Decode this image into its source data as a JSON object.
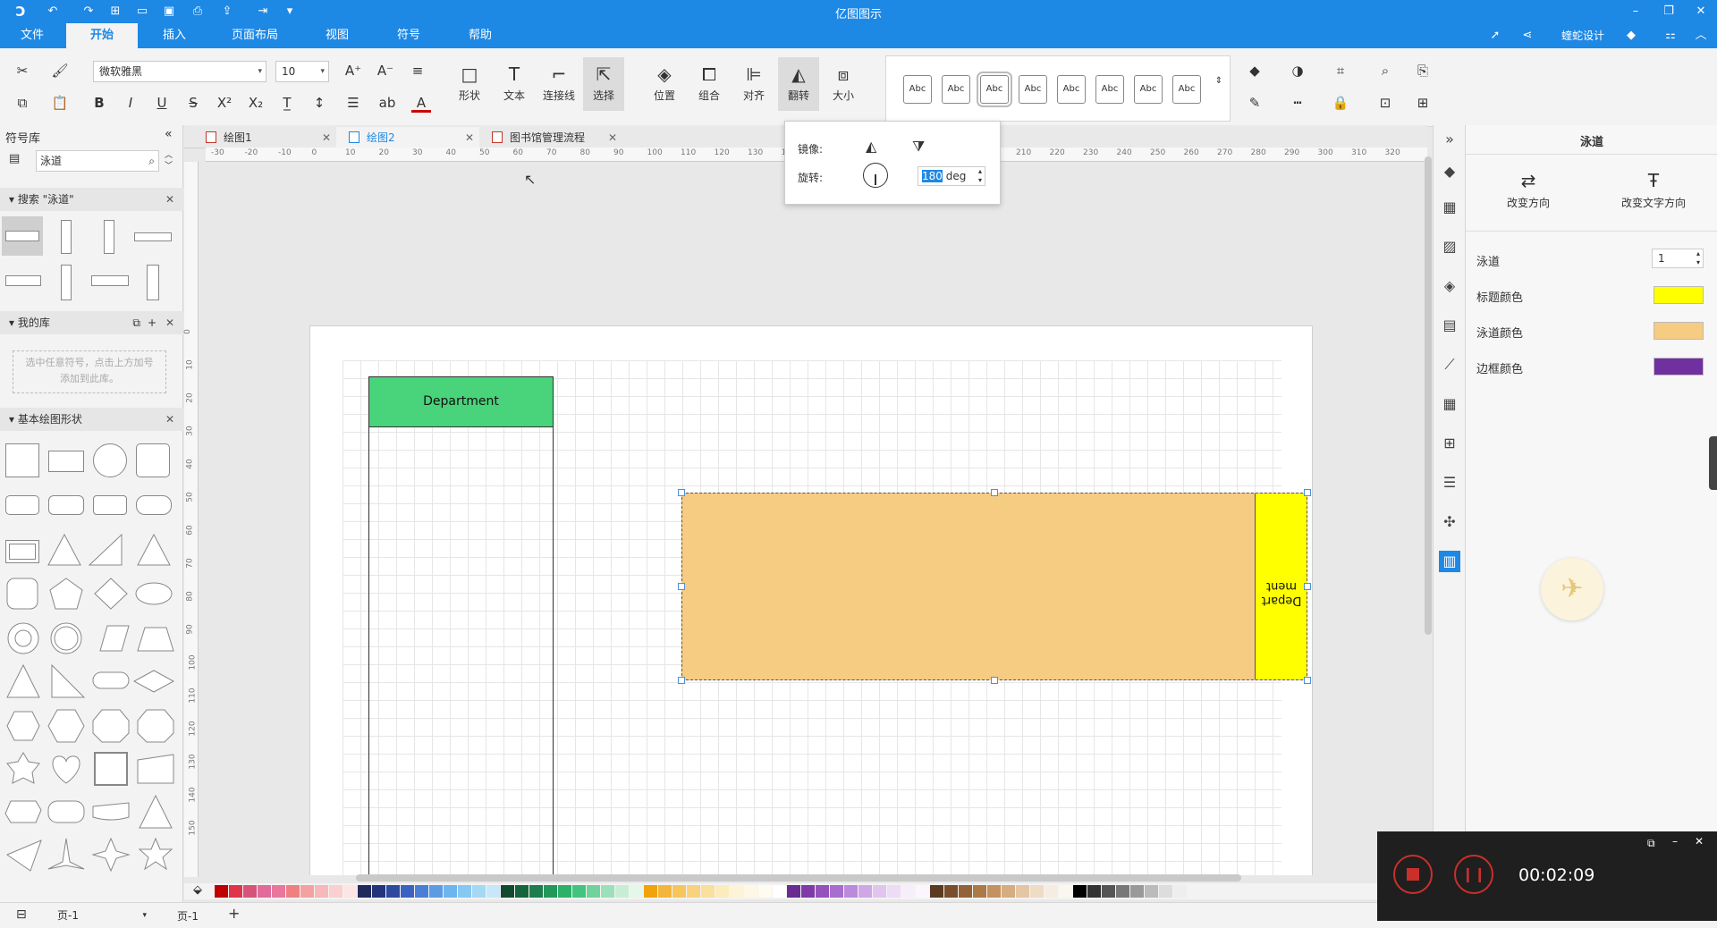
{
  "window": {
    "title": "亿图图示",
    "controls": [
      "minimize",
      "maximize",
      "close"
    ]
  },
  "quick_access": [
    "undo",
    "redo",
    "new",
    "open",
    "save",
    "print",
    "export",
    "share",
    "more"
  ],
  "menu": {
    "tabs": [
      "文件",
      "开始",
      "插入",
      "页面布局",
      "视图",
      "符号",
      "帮助"
    ],
    "active": "开始",
    "right_user": "蝰蛇设计"
  },
  "ribbon": {
    "font_name": "微软雅黑",
    "font_size": "10",
    "big_buttons": [
      "形状",
      "文本",
      "连接线",
      "选择",
      "位置",
      "组合",
      "对齐",
      "翻转",
      "大小"
    ],
    "style_swatch_label": "Abc"
  },
  "flip_popup": {
    "mirror_label": "镜像:",
    "rotate_label": "旋转:",
    "rotate_value": "180",
    "rotate_unit": "deg"
  },
  "left_panel": {
    "title": "符号库",
    "search_value": "泳道",
    "search_section": "搜索 \"泳道\"",
    "mylib_section": "我的库",
    "mylib_hint": "选中任意符号，点击上方加号添加到此库。",
    "basic_section": "基本绘图形状"
  },
  "doc_tabs": [
    {
      "label": "绘图1",
      "active": false
    },
    {
      "label": "绘图2",
      "active": true
    },
    {
      "label": "图书馆管理流程",
      "active": false
    }
  ],
  "ruler": {
    "h_ticks": [
      "-30",
      "-20",
      "-10",
      "0",
      "10",
      "20",
      "30",
      "40",
      "50",
      "60",
      "70",
      "80",
      "90",
      "100",
      "110",
      "120",
      "130",
      "140",
      "150",
      "160",
      "170",
      "180",
      "190",
      "200",
      "210",
      "220",
      "230",
      "240",
      "250",
      "260",
      "270",
      "280",
      "290",
      "300",
      "310",
      "320"
    ],
    "v_ticks": [
      "0",
      "10",
      "20",
      "30",
      "40",
      "50",
      "60",
      "70",
      "80",
      "90",
      "100",
      "110",
      "120",
      "130",
      "140",
      "150"
    ]
  },
  "canvas": {
    "lane1_header": "Department",
    "lane2_header": "Depart ment"
  },
  "right_panel": {
    "title": "泳道",
    "btn_change_direction": "改变方向",
    "btn_change_text_direction": "改变文字方向",
    "rows": [
      {
        "label": "泳道",
        "value": "1"
      },
      {
        "label": "标题颜色",
        "color": "#ffff00"
      },
      {
        "label": "泳道颜色",
        "color": "#f6cb82"
      },
      {
        "label": "边框颜色",
        "color": "#7030a0"
      }
    ]
  },
  "status": {
    "page_select": "页-1",
    "page_tab": "页-1",
    "add": "+"
  },
  "recorder": {
    "time": "00:02:09"
  },
  "palette": [
    "#c00000",
    "#e0344a",
    "#d6547a",
    "#e16b9b",
    "#e8769d",
    "#f08080",
    "#f4a1a1",
    "#f6b8b8",
    "#f9cfcf",
    "#fde5e5",
    "#1f2a5a",
    "#23347a",
    "#2d4a9e",
    "#3b62c2",
    "#4a7fd8",
    "#5c9be4",
    "#6db5ee",
    "#86c8f2",
    "#a5d8f5",
    "#c6e8fa",
    "#114b2f",
    "#16643d",
    "#1d7d4c",
    "#24975a",
    "#2db168",
    "#43c47e",
    "#6fd39b",
    "#9be0b8",
    "#c7eed5",
    "#e4f7ea",
    "#f0a30a",
    "#f3b53b",
    "#f6c65c",
    "#f8d27c",
    "#fadf9d",
    "#fcebbd",
    "#fdf3d6",
    "#fff7e6",
    "#fffbef",
    "#ffffff",
    "#6a2c91",
    "#7f3aa8",
    "#9452bd",
    "#a86ecd",
    "#bc8adb",
    "#cfa7e6",
    "#e1c4f0",
    "#eedcf7",
    "#f7eefb",
    "#fbf6fd",
    "#5c3a21",
    "#7a4e2c",
    "#946238",
    "#ad7946",
    "#c39260",
    "#d5ad80",
    "#e3c6a3",
    "#eedcc4",
    "#f6ece0",
    "#fbf6f0",
    "#000000",
    "#333333",
    "#555555",
    "#777777",
    "#999999",
    "#bbbbbb",
    "#dddddd",
    "#eeeeee"
  ]
}
